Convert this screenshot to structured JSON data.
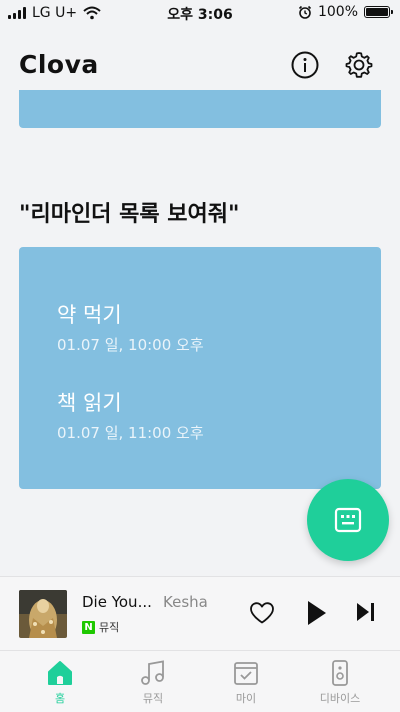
{
  "status_bar": {
    "carrier": "LG U+",
    "time": "오후 3:06",
    "battery": "100%",
    "battery_level": 1.0
  },
  "header": {
    "title": "Clova",
    "icons": [
      "info-icon",
      "gear-icon"
    ]
  },
  "query": "\"리마인더 목록 보여줘\"",
  "reminders": [
    {
      "title": "약 먹기",
      "time": "01.07 일, 10:00 오후"
    },
    {
      "title": "책 읽기",
      "time": "01.07 일, 11:00 오후"
    }
  ],
  "fab": {
    "icon": "keyboard-icon"
  },
  "player": {
    "song": "Die You...",
    "artist": "Kesha",
    "source_badge": "N",
    "source": "뮤직"
  },
  "tabs": [
    {
      "label": "홈",
      "icon": "home-icon",
      "active": true
    },
    {
      "label": "뮤직",
      "icon": "music-note-icon",
      "active": false
    },
    {
      "label": "마이",
      "icon": "calendar-check-icon",
      "active": false
    },
    {
      "label": "디바이스",
      "icon": "speaker-device-icon",
      "active": false
    }
  ],
  "colors": {
    "accent": "#1fcf9a",
    "card": "#83bfe0",
    "background": "#f2f3f5"
  }
}
